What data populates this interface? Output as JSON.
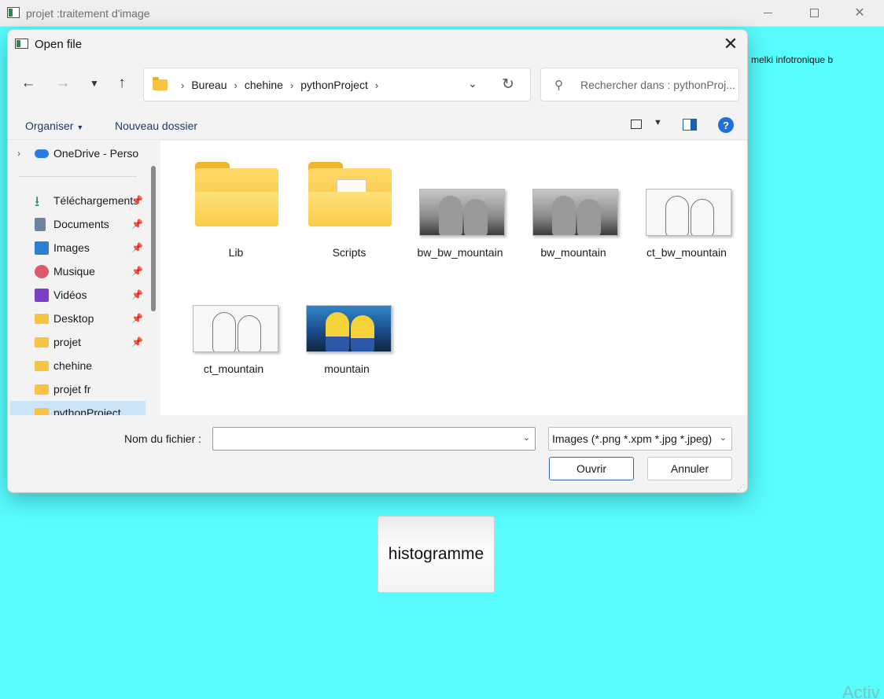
{
  "main_window": {
    "title": "projet :traitement d'image",
    "side_label": "melki infotronique b",
    "histogram_button": "histogramme",
    "watermark": "Activ"
  },
  "dialog": {
    "title": "Open file",
    "breadcrumbs": [
      "Bureau",
      "chehine",
      "pythonProject"
    ],
    "search_placeholder": "Rechercher dans : pythonProj...",
    "toolbar": {
      "organize": "Organiser",
      "new_folder": "Nouveau dossier"
    },
    "nav_items": [
      {
        "label": "OneDrive - Personal",
        "icon": "cloud-icon",
        "pinned": false
      },
      {
        "label": "Téléchargements",
        "icon": "download-icon",
        "pinned": true
      },
      {
        "label": "Documents",
        "icon": "document-icon",
        "pinned": true
      },
      {
        "label": "Images",
        "icon": "image-icon",
        "pinned": true
      },
      {
        "label": "Musique",
        "icon": "music-icon",
        "pinned": true
      },
      {
        "label": "Vidéos",
        "icon": "video-icon",
        "pinned": true
      },
      {
        "label": "Desktop",
        "icon": "folder-icon",
        "pinned": true
      },
      {
        "label": "projet",
        "icon": "folder-icon",
        "pinned": true
      },
      {
        "label": "chehine",
        "icon": "folder-icon",
        "pinned": false
      },
      {
        "label": "projet fr",
        "icon": "folder-icon",
        "pinned": false
      },
      {
        "label": "pythonProject",
        "icon": "folder-icon",
        "pinned": false,
        "selected": true
      }
    ],
    "files": [
      {
        "name": "Lib",
        "type": "folder"
      },
      {
        "name": "Scripts",
        "type": "folder"
      },
      {
        "name": "bw_bw_mountain",
        "type": "image-bw"
      },
      {
        "name": "bw_mountain",
        "type": "image-bw"
      },
      {
        "name": "ct_bw_mountain",
        "type": "image-contour"
      },
      {
        "name": "ct_mountain",
        "type": "image-contour"
      },
      {
        "name": "mountain",
        "type": "image-color"
      }
    ],
    "filename_label": "Nom du fichier :",
    "filename_value": "",
    "filter_value": "Images (*.png *.xpm *.jpg *.jpeg)",
    "open_button": "Ouvrir",
    "cancel_button": "Annuler"
  }
}
